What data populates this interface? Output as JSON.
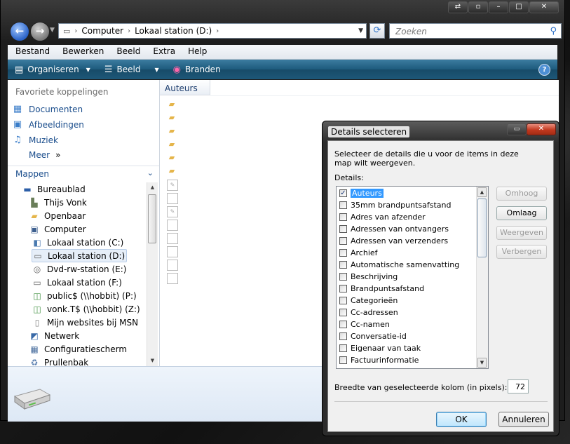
{
  "explorer": {
    "address": {
      "crumbs": [
        "Computer",
        "Lokaal station (D:)"
      ]
    },
    "search": {
      "placeholder": "Zoeken"
    },
    "menu": [
      "Bestand",
      "Bewerken",
      "Beeld",
      "Extra",
      "Help"
    ],
    "toolbar": {
      "organize": "Organiseren",
      "view": "Beeld",
      "burn": "Branden"
    },
    "navpane": {
      "favorites_title": "Favoriete koppelingen",
      "favorites": [
        "Documenten",
        "Afbeeldingen",
        "Muziek",
        "Meer"
      ],
      "favorites_more_suffix": "»",
      "folders_title": "Mappen",
      "tree": [
        {
          "label": "Bureaublad",
          "icon": "desktop-icon"
        },
        {
          "label": "Thijs Vonk",
          "icon": "user-folder-icon"
        },
        {
          "label": "Openbaar",
          "icon": "folder-icon"
        },
        {
          "label": "Computer",
          "icon": "computer-icon"
        },
        {
          "label": "Lokaal station (C:)",
          "icon": "windows-drive-icon"
        },
        {
          "label": "Lokaal station (D:)",
          "icon": "drive-icon",
          "selected": true
        },
        {
          "label": "Dvd-rw-station (E:)",
          "icon": "dvd-drive-icon"
        },
        {
          "label": "Lokaal station (F:)",
          "icon": "drive-icon"
        },
        {
          "label": "public$ (\\\\hobbit) (P:)",
          "icon": "network-drive-icon"
        },
        {
          "label": "vonk.T$ (\\\\hobbit) (Z:)",
          "icon": "network-drive-icon"
        },
        {
          "label": "Mijn websites bij MSN",
          "icon": "file-icon"
        },
        {
          "label": "Netwerk",
          "icon": "network-icon"
        },
        {
          "label": "Configuratiescherm",
          "icon": "control-panel-icon"
        },
        {
          "label": "Prullenbak",
          "icon": "recycle-bin-icon"
        }
      ]
    },
    "content": {
      "column_header": "Auteurs",
      "rows": [
        "folder",
        "folder",
        "folder",
        "folder",
        "folder",
        "folder",
        "doc",
        "file",
        "doc",
        "file",
        "file",
        "file",
        "file",
        "file"
      ]
    }
  },
  "dialog": {
    "title": "Details selecteren",
    "description": "Selecteer de details die u voor de items in deze map wilt weergeven.",
    "details_label": "Details:",
    "items": [
      {
        "label": "Auteurs",
        "checked": true,
        "selected": true
      },
      {
        "label": "35mm brandpuntsafstand",
        "checked": false
      },
      {
        "label": "Adres van afzender",
        "checked": false
      },
      {
        "label": "Adressen van ontvangers",
        "checked": false
      },
      {
        "label": "Adressen van verzenders",
        "checked": false
      },
      {
        "label": "Archief",
        "checked": false
      },
      {
        "label": "Automatische samenvatting",
        "checked": false
      },
      {
        "label": "Beschrijving",
        "checked": false
      },
      {
        "label": "Brandpuntsafstand",
        "checked": false
      },
      {
        "label": "Categorieën",
        "checked": false
      },
      {
        "label": "Cc-adressen",
        "checked": false
      },
      {
        "label": "Cc-namen",
        "checked": false
      },
      {
        "label": "Conversatie-id",
        "checked": false
      },
      {
        "label": "Eigenaar van taak",
        "checked": false
      },
      {
        "label": "Factuurinformatie",
        "checked": false
      }
    ],
    "side_buttons": [
      {
        "label": "Omhoog",
        "enabled": false
      },
      {
        "label": "Omlaag",
        "enabled": true
      },
      {
        "label": "Weergeven",
        "enabled": false
      },
      {
        "label": "Verbergen",
        "enabled": false
      }
    ],
    "width_label": "Breedte van geselecteerde kolom (in pixels):",
    "width_value": "72",
    "ok": "OK",
    "cancel": "Annuleren"
  }
}
